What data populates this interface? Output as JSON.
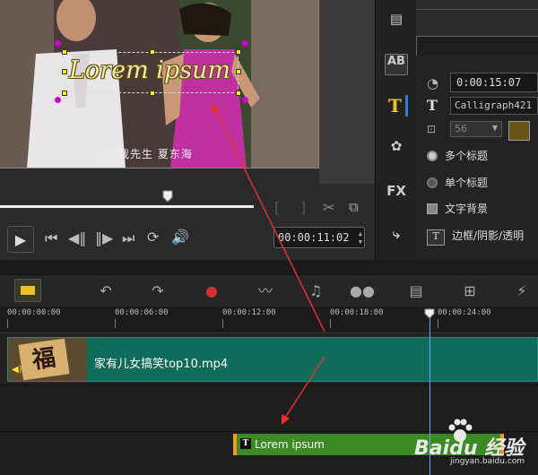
{
  "preview": {
    "subtitle": "这是我先生  夏东海",
    "title_overlay": "Lorem ipsum",
    "timecode": "00:00:11:02"
  },
  "options": {
    "duration": "0:00:15:07",
    "font": "Calligraph421",
    "font_size": "56",
    "multi_title": "多个标题",
    "single_title": "单个标题",
    "text_background": "文字背景",
    "border_shadow": "边框/阴影/透明"
  },
  "tools": [
    "instant-project-icon",
    "AB",
    "T",
    "particle-icon",
    "FX",
    "path-icon"
  ],
  "timeline": {
    "ruler": [
      "00:00:00:00",
      "00:00:06:00",
      "00:00:12:00",
      "00:00:18:00",
      "00:00:24:00"
    ],
    "video_clip": "家有儿女搞笑top10.mp4",
    "title_clip": "Lorem ipsum"
  },
  "watermark": {
    "brand": "Baidu 经验",
    "url": "jingyan.baidu.com"
  },
  "colors": {
    "title_text": "#f0e8a0",
    "video_clip": "#0f6b5a",
    "title_clip": "#3b8a22",
    "accent": "#2f7fd0",
    "arrow": "#e03030"
  }
}
